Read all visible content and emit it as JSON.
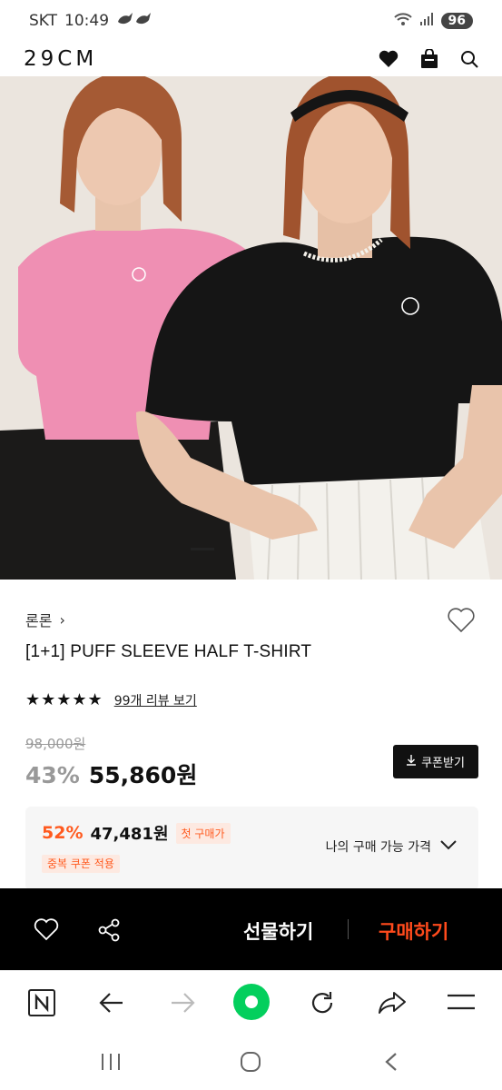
{
  "status_bar": {
    "carrier": "SKT",
    "time": "10:49",
    "battery": "96"
  },
  "app": {
    "logo": "29CM"
  },
  "product": {
    "brand": "론론",
    "brand_chevron": "›",
    "title": "[1+1] PUFF SLEEVE HALF T-SHIRT",
    "stars": "★★★★★",
    "review_link": "99개 리뷰 보기",
    "original_price": "98,000원",
    "discount": "43%",
    "sale_price": "55,860원",
    "coupon_button": "쿠폰받기"
  },
  "best_price": {
    "percent": "52%",
    "amount": "47,481원",
    "first_purchase_tag": "첫 구매가",
    "coupon_tag": "중복 쿠폰 적용",
    "my_price_label": "나의 구매 가능 가격"
  },
  "actions": {
    "gift": "선물하기",
    "buy": "구매하기"
  },
  "colors": {
    "accent": "#ff4a1c",
    "discount_orange": "#ff5a1f",
    "browser_green": "#03cf5d"
  }
}
